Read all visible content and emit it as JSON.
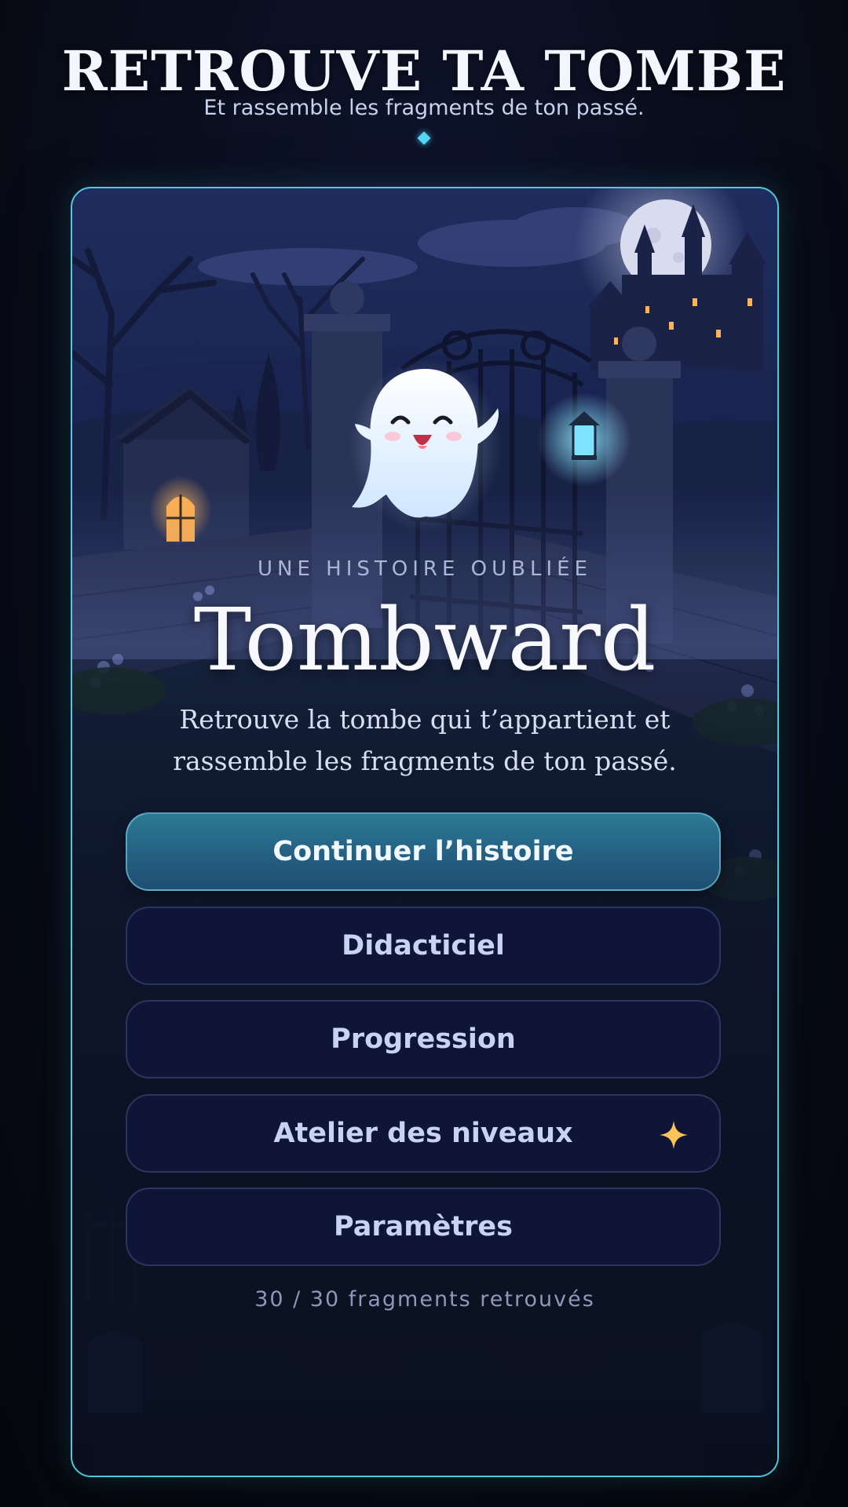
{
  "header": {
    "title": "RETROUVE TA TOMBE",
    "subtitle": "Et rassemble les fragments de ton passé."
  },
  "game": {
    "kicker": "UNE HISTOIRE OUBLIÉE",
    "title": "Tombward",
    "tagline": "Retrouve la tombe qui t’appartient et rassemble les fragments de ton passé."
  },
  "menu": {
    "buttons": [
      {
        "label": "Continuer l’histoire",
        "primary": true
      },
      {
        "label": "Didacticiel"
      },
      {
        "label": "Progression"
      },
      {
        "label": "Atelier des niveaux",
        "icon": "sparkle-icon"
      },
      {
        "label": "Paramètres"
      }
    ]
  },
  "progress": {
    "text": "30 / 30 fragments retrouvés",
    "found": 30,
    "total": 30
  },
  "colors": {
    "accent": "#4fc9dd",
    "primary_button": "#2c7a96",
    "button_bg": "#10163a",
    "star": "#ffc35a"
  },
  "scene": {
    "description_icons": [
      "moon",
      "castle",
      "chapel",
      "cemetery-gate",
      "lantern",
      "ghost-mascot"
    ]
  }
}
